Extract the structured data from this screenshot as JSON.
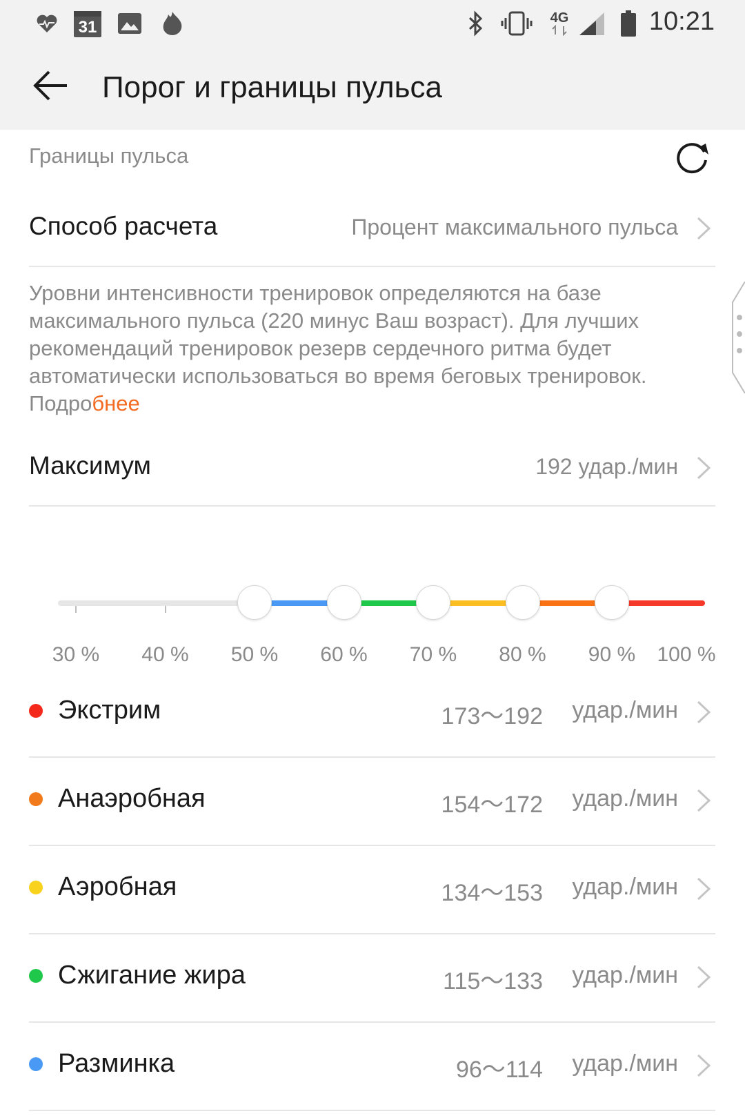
{
  "status_bar": {
    "time": "10:21",
    "calendar_day": "31",
    "network": "4G",
    "left_icons": [
      "heart-rate-icon",
      "calendar-icon",
      "gallery-icon",
      "fire-icon"
    ],
    "right_icons": [
      "bluetooth-icon",
      "vibrate-icon",
      "network-4g-icon",
      "signal-icon",
      "battery-icon"
    ]
  },
  "header": {
    "title": "Порог и границы пульса"
  },
  "section": {
    "title": "Границы пульса"
  },
  "method_row": {
    "label": "Способ расчета",
    "value": "Процент максимального пульса"
  },
  "description": {
    "text": "Уровни интенсивности тренировок определяются на базе максимального пульса (220 минус Ваш возраст). Для лучших рекомендаций тренировок резерв сердечного ритма будет автоматически использоваться во время беговых тренировок. Подро",
    "link": "бнее"
  },
  "max_row": {
    "label": "Максимум",
    "value": "192 удар./мин"
  },
  "slider": {
    "tick_labels": [
      "30 %",
      "40 %",
      "50 %",
      "60 %",
      "70 %",
      "80 %",
      "90 %",
      "100 %"
    ],
    "thresholds_percent": [
      50,
      60,
      70,
      80,
      90
    ],
    "segment_colors": [
      "#e6e6e6",
      "#4a9af5",
      "#1fc84a",
      "#fbbf24",
      "#f97316",
      "#f53a2a"
    ]
  },
  "zones": [
    {
      "name": "Экстрим",
      "range": "173〜192",
      "unit": "удар./мин",
      "color": "#f5291b"
    },
    {
      "name": "Анаэробная",
      "range": "154〜172",
      "unit": "удар./мин",
      "color": "#f07a1c"
    },
    {
      "name": "Аэробная",
      "range": "134〜153",
      "unit": "удар./мин",
      "color": "#f9d21e"
    },
    {
      "name": "Сжигание жира",
      "range": "115〜133",
      "unit": "удар./мин",
      "color": "#1fc84a"
    },
    {
      "name": "Разминка",
      "range": "96〜114",
      "unit": "удар./мин",
      "color": "#4a9af5"
    }
  ]
}
